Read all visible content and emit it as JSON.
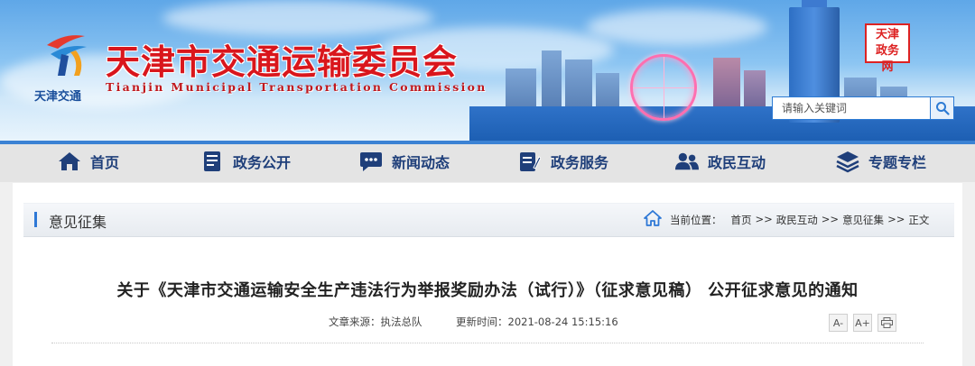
{
  "header": {
    "site_title": "天津市交通运输委员会",
    "site_subtitle": "Tianjin Municipal Transportation Commission",
    "logo_caption": "天津交通",
    "seal_text": "天津政务网",
    "search_placeholder": "请输入关键词"
  },
  "nav": {
    "items": [
      {
        "label": "首页",
        "icon": "home-icon"
      },
      {
        "label": "政务公开",
        "icon": "document-icon"
      },
      {
        "label": "新闻动态",
        "icon": "chat-bubble-icon"
      },
      {
        "label": "政务服务",
        "icon": "clipboard-edit-icon"
      },
      {
        "label": "政民互动",
        "icon": "users-icon"
      },
      {
        "label": "专题专栏",
        "icon": "layers-icon"
      }
    ]
  },
  "section": {
    "title": "意见征集",
    "breadcrumb_prefix": "当前位置：",
    "breadcrumb": [
      "首页",
      "政民互动",
      "意见征集",
      "正文"
    ],
    "breadcrumb_sep": ">>"
  },
  "article": {
    "title": "关于《天津市交通运输安全生产违法行为举报奖励办法（试行）》（征求意见稿） 公开征求意见的通知",
    "source_label": "文章来源：",
    "source": "执法总队",
    "updated_label": "更新时间：",
    "updated": "2021-08-24 15:15:16",
    "font_smaller": "A-",
    "font_larger": "A+"
  },
  "colors": {
    "title_red": "#d9161c",
    "nav_text": "#1f3f7a",
    "accent_blue": "#2e78d6",
    "nav_bg": "#e4e4e4"
  }
}
